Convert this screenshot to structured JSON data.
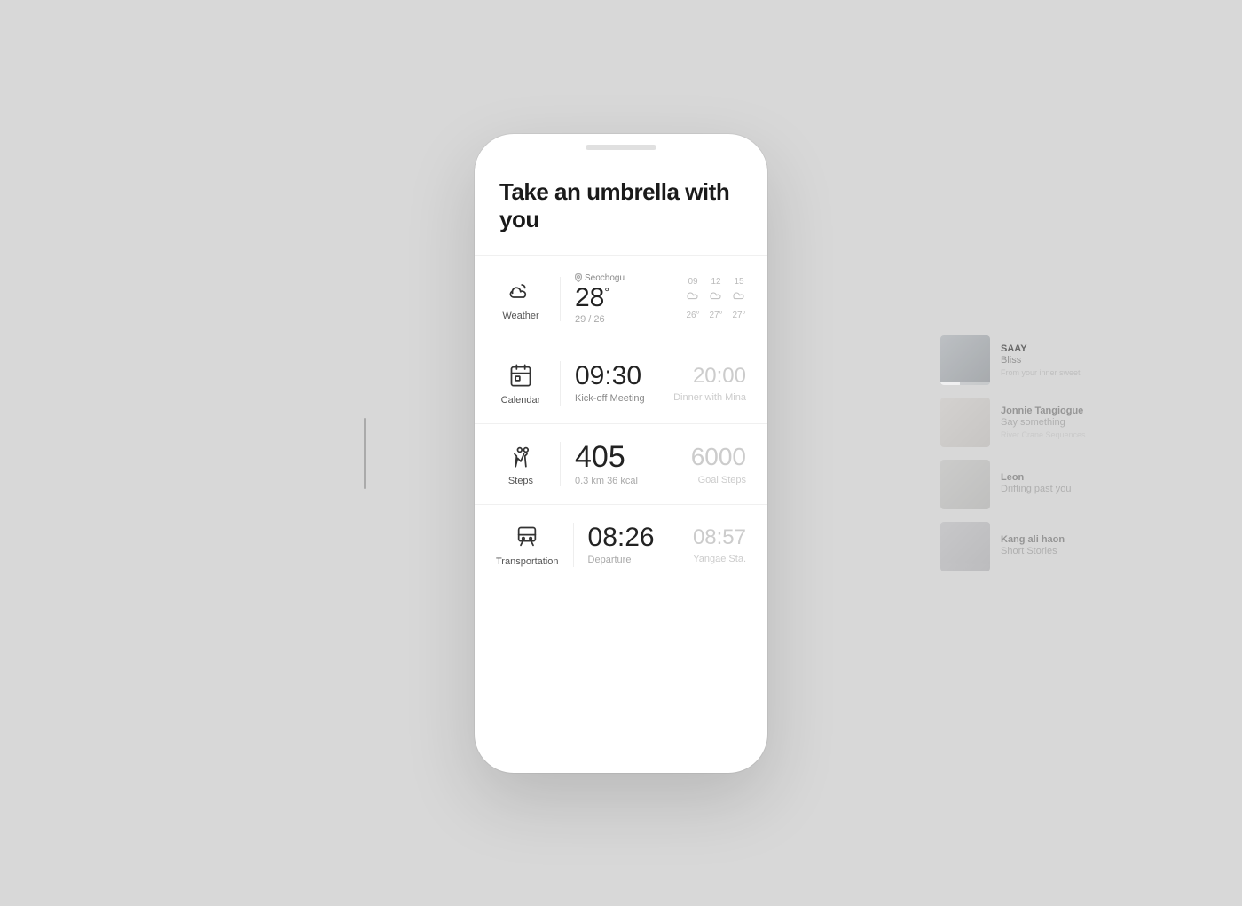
{
  "hero": {
    "title": "Take an umbrella with you"
  },
  "weather": {
    "label": "Weather",
    "location": "Seochogu",
    "temp": "28",
    "range": "29 / 26",
    "forecast": [
      {
        "hour": "09",
        "temp": "26°"
      },
      {
        "hour": "12",
        "temp": "27°"
      },
      {
        "hour": "15",
        "temp": "27°"
      }
    ]
  },
  "calendar": {
    "label": "Calendar",
    "time": "09:30",
    "event": "Kick-off Meeting",
    "time2": "20:00",
    "event2": "Dinner with Mina"
  },
  "steps": {
    "label": "Steps",
    "count": "405",
    "detail": "0.3 km  36 kcal",
    "goal": "6000",
    "goal_label": "Goal Steps"
  },
  "transportation": {
    "label": "Transportation",
    "time": "08:26",
    "sub_label": "Departure",
    "time2": "08:57",
    "station": "Yangae Sta."
  },
  "music": {
    "tracks": [
      {
        "artist": "SAAY",
        "title": "Bliss",
        "desc": "From your inner sweet"
      },
      {
        "artist": "Jonnie Tangiogue",
        "title": "Say something",
        "desc": "River Crane Sequences..."
      },
      {
        "artist": "Leon",
        "title": "Drifting past you",
        "desc": ""
      },
      {
        "artist": "Kang ali haon",
        "title": "Short Stories",
        "desc": ""
      }
    ]
  }
}
